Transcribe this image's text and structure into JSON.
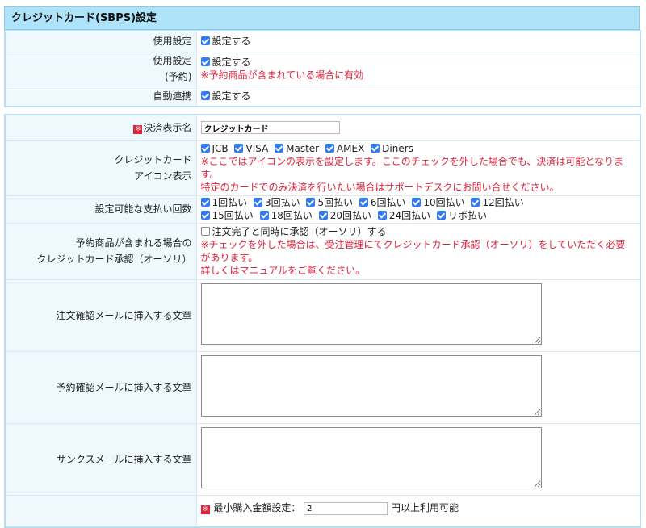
{
  "header": {
    "title": "クレジットカード(SBPS)設定"
  },
  "top": {
    "usage": {
      "label": "使用設定",
      "checkbox": "設定する"
    },
    "reserve": {
      "label_line1": "使用設定",
      "label_line2": "(予約)",
      "checkbox": "設定する",
      "note": "※予約商品が含まれている場合に有効"
    },
    "auto": {
      "label": "自動連携",
      "checkbox": "設定する"
    }
  },
  "main": {
    "payment_name": {
      "required_mark": "※",
      "label": "決済表示名",
      "value": "クレジットカード"
    },
    "card_icons": {
      "label_line1": "クレジットカード",
      "label_line2": "アイコン表示",
      "cards": [
        "JCB",
        "VISA",
        "Master",
        "AMEX",
        "Diners"
      ],
      "note_line1": "※ここではアイコンの表示を設定します。ここのチェックを外した場合でも、決済は可能となりま",
      "note_line2": "す。",
      "note_line3": "特定のカードでのみ決済を行いたい場合はサポートデスクにお問い合せください。"
    },
    "installments": {
      "label": "設定可能な支払い回数",
      "row1": [
        "1回払い",
        "3回払い",
        "5回払い",
        "6回払い",
        "10回払い",
        "12回払い"
      ],
      "row2": [
        "15回払い",
        "18回払い",
        "20回払い",
        "24回払い",
        "リボ払い"
      ]
    },
    "reserve_auth": {
      "label_line1": "予約商品が含まれる場合の",
      "label_line2": "クレジットカード承認（オーソリ）",
      "checkbox": "注文完了と同時に承認（オーソリ）する",
      "note_line1": "※チェックを外した場合は、受注管理にてクレジットカード承認（オーソリ）をしていただく必要",
      "note_line2": "があります。",
      "note_line3": "詳しくはマニュアルをご覧ください。"
    },
    "order_mail": {
      "label": "注文確認メールに挿入する文章",
      "value": ""
    },
    "reserve_mail": {
      "label": "予約確認メールに挿入する文章",
      "value": ""
    },
    "thanks_mail": {
      "label": "サンクスメールに挿入する文章",
      "value": ""
    },
    "min_amount": {
      "required_mark": "※",
      "label": "最小購入金額設定：",
      "value": "2",
      "suffix": "円以上利用可能"
    }
  }
}
